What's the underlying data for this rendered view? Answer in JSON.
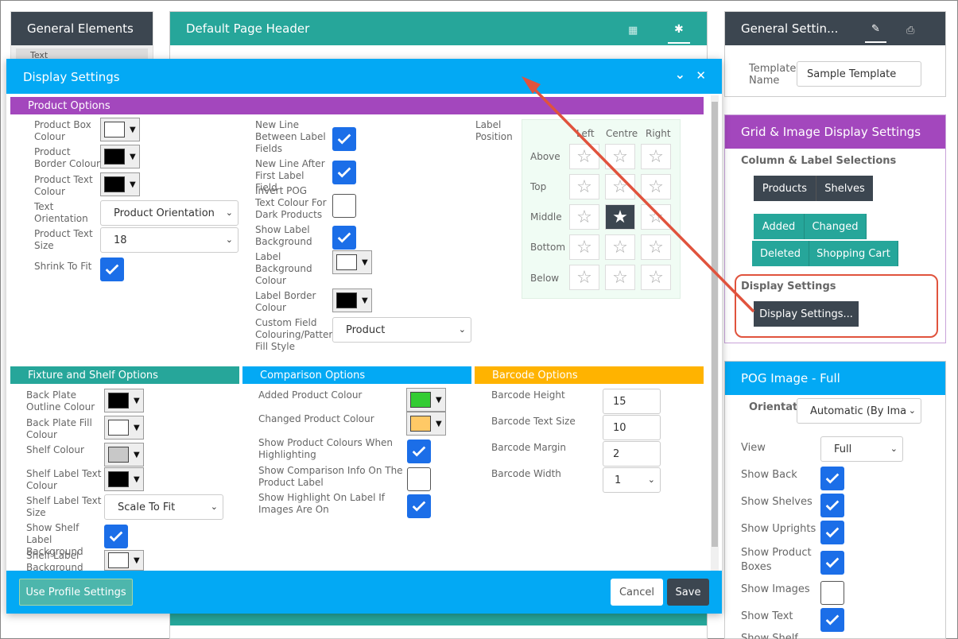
{
  "left_panel": {
    "title": "General Elements",
    "item": "Text"
  },
  "center_panel": {
    "title": "Default Page Header"
  },
  "right_general": {
    "title": "General Settin...",
    "template_name_label": "Template Name",
    "template_name_value": "Sample Template"
  },
  "right_grid": {
    "title": "Grid & Image Display Settings",
    "col_label_heading": "Column & Label Selections",
    "tabs1": [
      "Products",
      "Shelves"
    ],
    "tabs2": [
      "Added",
      "Changed"
    ],
    "tabs3": [
      "Deleted",
      "Shopping Cart"
    ],
    "display_heading": "Display Settings",
    "display_button": "Display Settings..."
  },
  "right_pog": {
    "title": "POG Image - Full",
    "orientation_label": "Orientati",
    "orientation_value": "Automatic (By Ima",
    "view_label": "View",
    "view_value": "Full",
    "show_back": "Show Back",
    "show_shelves": "Show Shelves",
    "show_uprights": "Show Uprights",
    "show_product_boxes": "Show Product Boxes",
    "show_images": "Show Images",
    "show_text": "Show Text",
    "show_shelf": "Show Shelf"
  },
  "modal": {
    "title": "Display Settings",
    "product_options": {
      "heading": "Product Options",
      "product_box_colour": "Product Box Colour",
      "product_border_colour": "Product Border Colour",
      "product_text_colour": "Product Text Colour",
      "text_orientation": "Text Orientation",
      "text_orientation_value": "Product Orientation",
      "product_text_size": "Product Text Size",
      "product_text_size_value": "18",
      "shrink_to_fit": "Shrink To Fit",
      "new_line_between": "New Line Between Label Fields",
      "new_line_after": "New Line After First Label Field",
      "invert_pog": "Invert POG Text Colour For Dark Products",
      "show_label_bg": "Show Label Background",
      "label_bg_colour": "Label Background Colour",
      "label_border_colour": "Label Border Colour",
      "custom_field": "Custom Field Colouring/Pattern Fill Style",
      "custom_field_value": "Product",
      "label_position": "Label Position",
      "cols": [
        "Left",
        "Centre",
        "Right"
      ],
      "rows": [
        "Above",
        "Top",
        "Middle",
        "Bottom",
        "Below"
      ]
    },
    "fixture": {
      "heading": "Fixture and Shelf Options",
      "back_plate_outline": "Back Plate Outline Colour",
      "back_plate_fill": "Back Plate Fill Colour",
      "shelf_colour": "Shelf Colour",
      "shelf_label_text_colour": "Shelf Label Text Colour",
      "shelf_label_text_size": "Shelf Label Text Size",
      "shelf_label_text_size_value": "Scale To Fit",
      "show_shelf_label_bg": "Show Shelf Label Background",
      "shelf_label_bg": "Shelf Label Background"
    },
    "comparison": {
      "heading": "Comparison Options",
      "added_colour": "Added Product Colour",
      "changed_colour": "Changed Product Colour",
      "show_colours": "Show Product Colours When Highlighting",
      "show_info": "Show Comparison Info On The Product Label",
      "show_highlight": "Show Highlight On Label If Images Are On"
    },
    "barcode": {
      "heading": "Barcode Options",
      "height": "Barcode Height",
      "height_value": "15",
      "text_size": "Barcode Text Size",
      "text_size_value": "10",
      "margin": "Barcode Margin",
      "margin_value": "2",
      "width": "Barcode Width",
      "width_value": "1"
    },
    "footer": {
      "profile": "Use Profile Settings",
      "cancel": "Cancel",
      "save": "Save"
    }
  },
  "colors": {
    "purple": "#a347bd",
    "teal": "#26a69a",
    "blue": "#03a9f4",
    "orange": "#ffb300",
    "dark": "#3c4650",
    "check": "#1b6ee8",
    "annotation": "#e0533d"
  }
}
